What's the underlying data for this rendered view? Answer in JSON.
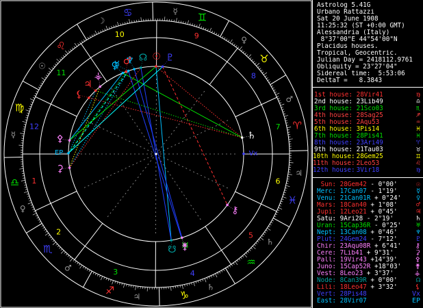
{
  "header": {
    "line1": "Astrolog 5.41G",
    "line2": "Urbano Rattazzi",
    "line3": "Sat 20 June 1908",
    "line4": "11:25:32 (ST +0:00 GMT)",
    "line5": "Alessandria (Italy)",
    "line6": " 8°37'00\"E 44°54'00\"N",
    "line7": "Placidus houses.",
    "line8": "Tropical, Geocentric.",
    "line9": "Julian Day = 2418112.9761",
    "line10": "Obliquity = 23°27'04\"",
    "line11": "Sidereal time:  5:53:06",
    "line12": "DeltaT =   8.3843"
  },
  "houses": [
    {
      "name": "1st house:",
      "value": "28Vir41",
      "glyph": "♍",
      "color": "#ff3030"
    },
    {
      "name": "2nd house:",
      "value": "23Lib49",
      "glyph": "♎",
      "color": "#ffffff"
    },
    {
      "name": "3rd house:",
      "value": "21Sco03",
      "glyph": "♏",
      "color": "#00e000"
    },
    {
      "name": "4th house:",
      "value": "28Sag25",
      "glyph": "♐",
      "color": "#ff4040"
    },
    {
      "name": "5th house:",
      "value": "2Aqu53",
      "glyph": "♒",
      "color": "#ff4040"
    },
    {
      "name": "6th house:",
      "value": "3Pis14",
      "glyph": "♓",
      "color": "#ffff00"
    },
    {
      "name": "7th house:",
      "value": "28Pis41",
      "glyph": "♓",
      "color": "#00e000"
    },
    {
      "name": "8th house:",
      "value": "23Ari49",
      "glyph": "♈",
      "color": "#4040ff"
    },
    {
      "name": "9th house:",
      "value": "21Tau03",
      "glyph": "♉",
      "color": "#ffffff"
    },
    {
      "name": "10th house:",
      "value": "28Gem25",
      "glyph": "♊",
      "color": "#ffff00"
    },
    {
      "name": "11th house:",
      "value": "2Leo53",
      "glyph": "♌",
      "color": "#ff4040"
    },
    {
      "name": "12th house:",
      "value": "3Vir18",
      "glyph": "♍",
      "color": "#4040ff"
    }
  ],
  "planets": [
    {
      "name": "Sun:",
      "value": "28Gem42",
      "extra": " - 0°00'",
      "glyph": "☉",
      "color": "#ff3030"
    },
    {
      "name": "Merc:",
      "value": "17Can07",
      "extra": " - 1°19'",
      "glyph": "☿",
      "color": "#00c0ff"
    },
    {
      "name": "Venu:",
      "value": "21Can01R",
      "extra": " + 0°24'",
      "glyph": "♀",
      "color": "#00c0ff"
    },
    {
      "name": "Mars:",
      "value": "18Can40",
      "extra": " + 1°08'",
      "glyph": "♂",
      "color": "#ff3030"
    },
    {
      "name": "Jupi:",
      "value": "12Leo21",
      "extra": " + 0°45'",
      "glyph": "♃",
      "color": "#ff3030"
    },
    {
      "name": "Satu:",
      "value": "9Ari28",
      "extra": " - 2°19'",
      "glyph": "♄",
      "color": "#ffffff"
    },
    {
      "name": "Uran:",
      "value": "15Cap36R",
      "extra": " - 0°25'",
      "glyph": "♅",
      "color": "#00e000"
    },
    {
      "name": "Nept:",
      "value": "13Can08",
      "extra": " + 0°46'",
      "glyph": "♆",
      "color": "#00c0ff"
    },
    {
      "name": "Plut:",
      "value": "24Gem24",
      "extra": " - 7°12'",
      "glyph": "♇",
      "color": "#4040ff"
    },
    {
      "name": "Chir:",
      "value": "23Aqu08R",
      "extra": " + 6°41'",
      "glyph": "⚷",
      "color": "#ff80ff"
    },
    {
      "name": "Cere:",
      "value": "7Lib41",
      "extra": " + 9°31'",
      "glyph": "⚳",
      "color": "#ff80ff"
    },
    {
      "name": "Pall:",
      "value": "19Vir43",
      "extra": " +14°39'",
      "glyph": "⚴",
      "color": "#ff80ff"
    },
    {
      "name": "Juno:",
      "value": "15Cap52R",
      "extra": " +18°03'",
      "glyph": "⚵",
      "color": "#ff80ff"
    },
    {
      "name": "Vest:",
      "value": "8Leo23",
      "extra": " + 3°37'",
      "glyph": "⚶",
      "color": "#ff80ff"
    },
    {
      "name": "Node:",
      "value": "8Can39R",
      "extra": " + 0°00'",
      "glyph": "☊",
      "color": "#00a0a0"
    },
    {
      "name": "Lili:",
      "value": "18Leo47",
      "extra": " + 3°32'",
      "glyph": "⚸",
      "color": "#ff3030"
    },
    {
      "name": "Vert:",
      "value": "28Pis48",
      "extra": "",
      "glyph": "Vx",
      "color": "#4040ff"
    },
    {
      "name": "East:",
      "value": "28Vir07",
      "extra": "",
      "glyph": "EP",
      "color": "#00c0ff"
    }
  ],
  "colors": {
    "fire": "#ff3030",
    "earth": "#ffff00",
    "air": "#00e000",
    "water": "#4040ff",
    "pale_blue": "#00c0ff",
    "cyan": "#00ffff",
    "magenta": "#ff80ff",
    "white": "#ffffff",
    "gray": "#9a9a9a",
    "dim_blue": "#1f3fff",
    "orange": "#ff8000",
    "dark_red": "#c00000",
    "teal": "#00a0a0"
  },
  "chart": {
    "ascendant": "28Vir41",
    "signs": [
      {
        "name": "Aries",
        "glyph": "♈",
        "color": "#ff3030"
      },
      {
        "name": "Taurus",
        "glyph": "♉",
        "color": "#ffff00"
      },
      {
        "name": "Gemini",
        "glyph": "♊",
        "color": "#00e000"
      },
      {
        "name": "Cancer",
        "glyph": "♋",
        "color": "#4040ff"
      },
      {
        "name": "Leo",
        "glyph": "♌",
        "color": "#ff3030"
      },
      {
        "name": "Virgo",
        "glyph": "♍",
        "color": "#ffff00"
      },
      {
        "name": "Libra",
        "glyph": "♎",
        "color": "#00e000"
      },
      {
        "name": "Scorpio",
        "glyph": "♏",
        "color": "#4040ff"
      },
      {
        "name": "Sagittarius",
        "glyph": "♐",
        "color": "#ff3030"
      },
      {
        "name": "Capricorn",
        "glyph": "♑",
        "color": "#ffff00"
      },
      {
        "name": "Aquarius",
        "glyph": "♒",
        "color": "#00e000"
      },
      {
        "name": "Pisces",
        "glyph": "♓",
        "color": "#4040ff"
      }
    ],
    "ruler_glyphs": [
      "♂",
      "♀",
      "☿",
      "☽",
      "☉",
      "☿",
      "♀",
      "♂",
      "♃",
      "♄",
      "♄",
      "♃"
    ],
    "house_cusps": [
      178.68,
      203.82,
      231.05,
      268.42,
      302.88,
      333.23,
      358.68,
      23.82,
      51.05,
      88.42,
      122.88,
      153.3
    ],
    "house_numbers": [
      "1",
      "2",
      "3",
      "4",
      "5",
      "6",
      "7",
      "8",
      "9",
      "10",
      "11",
      "12"
    ],
    "house_number_colors": [
      "#ff3030",
      "#ffff00",
      "#00e000",
      "#4040ff",
      "#ff3030",
      "#ffff00",
      "#00e000",
      "#4040ff",
      "#ff3030",
      "#ffff00",
      "#00e000",
      "#4040ff"
    ],
    "points": [
      {
        "name": "Sun",
        "glyph": "☉",
        "lon": 88.7,
        "color": "#ff3030"
      },
      {
        "name": "Mercury",
        "glyph": "☿",
        "lon": 107.12,
        "color": "#00c0ff"
      },
      {
        "name": "Venus",
        "glyph": "♀",
        "lon": 111.02,
        "color": "#00c0ff"
      },
      {
        "name": "Mars",
        "glyph": "♂",
        "lon": 108.67,
        "color": "#ff3030"
      },
      {
        "name": "Jupiter",
        "glyph": "♃",
        "lon": 132.35,
        "color": "#ff3030"
      },
      {
        "name": "Saturn",
        "glyph": "♄",
        "lon": 9.47,
        "color": "#ffffff"
      },
      {
        "name": "Uranus",
        "glyph": "♅",
        "lon": 285.6,
        "color": "#00e000"
      },
      {
        "name": "Neptune",
        "glyph": "♆",
        "lon": 103.13,
        "color": "#00c0ff"
      },
      {
        "name": "Pluto",
        "glyph": "♇",
        "lon": 84.4,
        "color": "#4040ff"
      },
      {
        "name": "Chiron",
        "glyph": "⚷",
        "lon": 323.13,
        "color": "#ff80ff"
      },
      {
        "name": "Ceres",
        "glyph": "⚳",
        "lon": 187.68,
        "color": "#ff80ff"
      },
      {
        "name": "Pallas",
        "glyph": "⚴",
        "lon": 169.72,
        "color": "#ff80ff"
      },
      {
        "name": "Juno",
        "glyph": "⚵",
        "lon": 285.87,
        "color": "#ff80ff"
      },
      {
        "name": "Vesta",
        "glyph": "⚶",
        "lon": 128.38,
        "color": "#ff80ff"
      },
      {
        "name": "North Node",
        "glyph": "☊",
        "lon": 98.65,
        "color": "#00a0a0"
      },
      {
        "name": "South Node",
        "glyph": "☋",
        "lon": 278.65,
        "color": "#00a0a0"
      },
      {
        "name": "Lilith",
        "glyph": "⚸",
        "lon": 138.78,
        "color": "#ff3030"
      },
      {
        "name": "Vertex",
        "glyph": "Vx",
        "lon": 358.8,
        "color": "#4040ff"
      },
      {
        "name": "East Point",
        "glyph": "EP",
        "lon": 178.12,
        "color": "#00c0ff"
      }
    ],
    "aspects": [
      {
        "from": 88.7,
        "to": 9.47,
        "color": "#ff3030",
        "style": "dot"
      },
      {
        "from": 111.02,
        "to": 9.47,
        "color": "#00e000",
        "style": "solid"
      },
      {
        "from": 88.7,
        "to": 278.65,
        "color": "#00c0ff",
        "style": "solid"
      },
      {
        "from": 107.12,
        "to": 285.6,
        "color": "#1f3fff",
        "style": "solid"
      },
      {
        "from": 103.13,
        "to": 285.87,
        "color": "#1f3fff",
        "style": "solid"
      },
      {
        "from": 98.65,
        "to": 278.65,
        "color": "#1f3fff",
        "style": "solid"
      },
      {
        "from": 84.4,
        "to": 323.13,
        "color": "#ff3030",
        "style": "dash"
      },
      {
        "from": 132.35,
        "to": 9.47,
        "color": "#00e000",
        "style": "dot"
      },
      {
        "from": 187.68,
        "to": 107.12,
        "color": "#00c0ff",
        "style": "dot"
      },
      {
        "from": 169.72,
        "to": 111.02,
        "color": "#00c0ff",
        "style": "solid"
      },
      {
        "from": 178.12,
        "to": 108.67,
        "color": "#00e000",
        "style": "dot"
      },
      {
        "from": 178.68,
        "to": 132.35,
        "color": "#00c0ff",
        "style": "dot"
      },
      {
        "from": 169.72,
        "to": 88.7,
        "color": "#00e000",
        "style": "solid"
      },
      {
        "from": 138.78,
        "to": 9.47,
        "color": "#ff3030",
        "style": "dot"
      },
      {
        "from": 187.68,
        "to": 98.65,
        "color": "#ff3030",
        "style": "dot"
      },
      {
        "from": 128.38,
        "to": 187.68,
        "color": "#ffff00",
        "style": "dot"
      },
      {
        "from": 84.4,
        "to": 178.12,
        "color": "#00ffff",
        "style": "solid"
      },
      {
        "from": 107.12,
        "to": 178.68,
        "color": "#00ffff",
        "style": "dash"
      }
    ]
  }
}
